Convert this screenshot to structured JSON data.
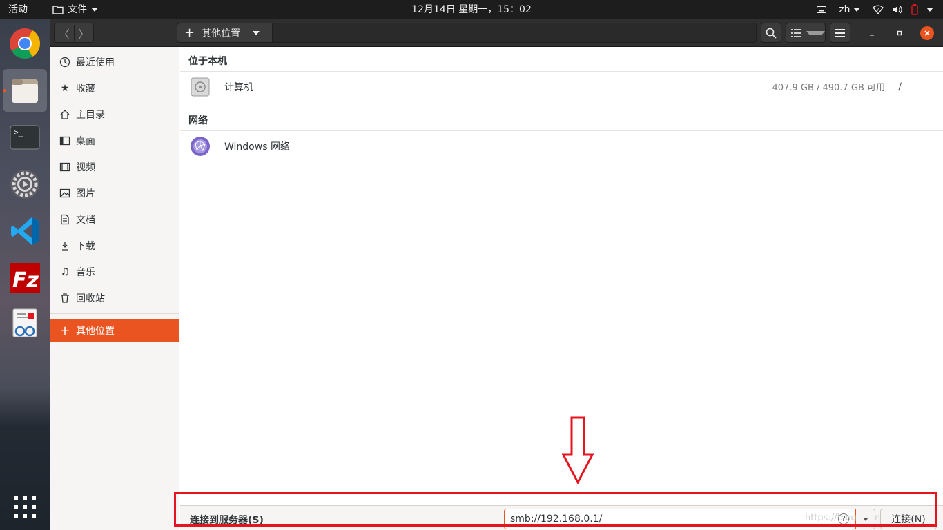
{
  "topbar": {
    "activities": "活动",
    "app_menu": "文件",
    "clock": "12月14日 星期一，15：02",
    "input_method": "zh"
  },
  "dock": {
    "items": [
      "chrome",
      "files",
      "terminal",
      "settings",
      "vscode",
      "filezilla",
      "document-viewer"
    ]
  },
  "pathbar": {
    "current": "其他位置"
  },
  "sidebar": {
    "items": [
      {
        "label": "最近使用",
        "icon": "clock-icon"
      },
      {
        "label": "收藏",
        "icon": "star-icon"
      },
      {
        "label": "主目录",
        "icon": "home-icon"
      },
      {
        "label": "桌面",
        "icon": "desktop-icon"
      },
      {
        "label": "视频",
        "icon": "video-icon"
      },
      {
        "label": "图片",
        "icon": "image-icon"
      },
      {
        "label": "文档",
        "icon": "document-icon"
      },
      {
        "label": "下载",
        "icon": "download-icon"
      },
      {
        "label": "音乐",
        "icon": "music-icon"
      },
      {
        "label": "回收站",
        "icon": "trash-icon"
      }
    ],
    "other": {
      "label": "其他位置",
      "icon": "plus-icon"
    }
  },
  "main": {
    "local_title": "位于本机",
    "computer": {
      "name": "计算机",
      "space": "407.9 GB / 490.7 GB 可用",
      "mount": "/"
    },
    "network_title": "网络",
    "windows_network": {
      "name": "Windows 网络"
    }
  },
  "connect": {
    "label": "连接到服务器(S)",
    "value": "smb://192.168.0.1/",
    "help": "?",
    "button": "连接(N)",
    "watermark": "https://blog.csdn.net/..."
  },
  "colors": {
    "accent": "#e95420",
    "annotation": "#e5141e"
  }
}
